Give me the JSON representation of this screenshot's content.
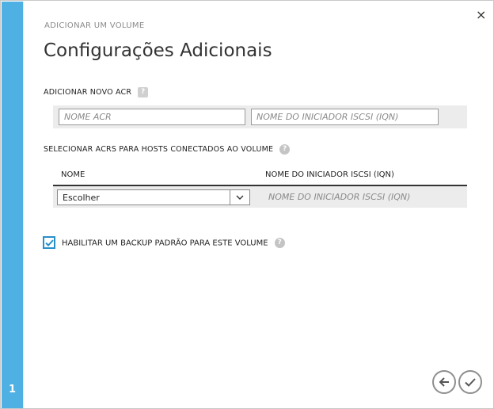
{
  "wizard": {
    "step_number": "1",
    "breadcrumb": "ADICIONAR UM VOLUME",
    "title": "Configurações Adicionais",
    "close_glyph": "×"
  },
  "new_acr": {
    "label": "ADICIONAR NOVO ACR",
    "help_icon": "?",
    "name_placeholder": "NOME ACR",
    "iqn_placeholder": "NOME DO INICIADOR ISCSI (IQN)"
  },
  "select_acrs": {
    "label": "SELECIONAR ACRS PARA HOSTS CONECTADOS AO VOLUME",
    "help_icon": "?",
    "columns": [
      "NOME",
      "NOME DO INICIADOR ISCSI (IQN)"
    ],
    "row": {
      "select_value": "Escolher",
      "iqn_placeholder": "NOME DO INICIADOR ISCSI (IQN)"
    }
  },
  "backup": {
    "checked": true,
    "label": "HABILITAR UM BACKUP PADRÃO PARA ESTE VOLUME",
    "help_icon": "?"
  },
  "footer": {
    "back_icon": "arrow-left-icon",
    "finish_icon": "checkmark-icon"
  },
  "colors": {
    "step_bar": "#4fb0e3",
    "checkbox_accent": "#2a8fc9"
  }
}
